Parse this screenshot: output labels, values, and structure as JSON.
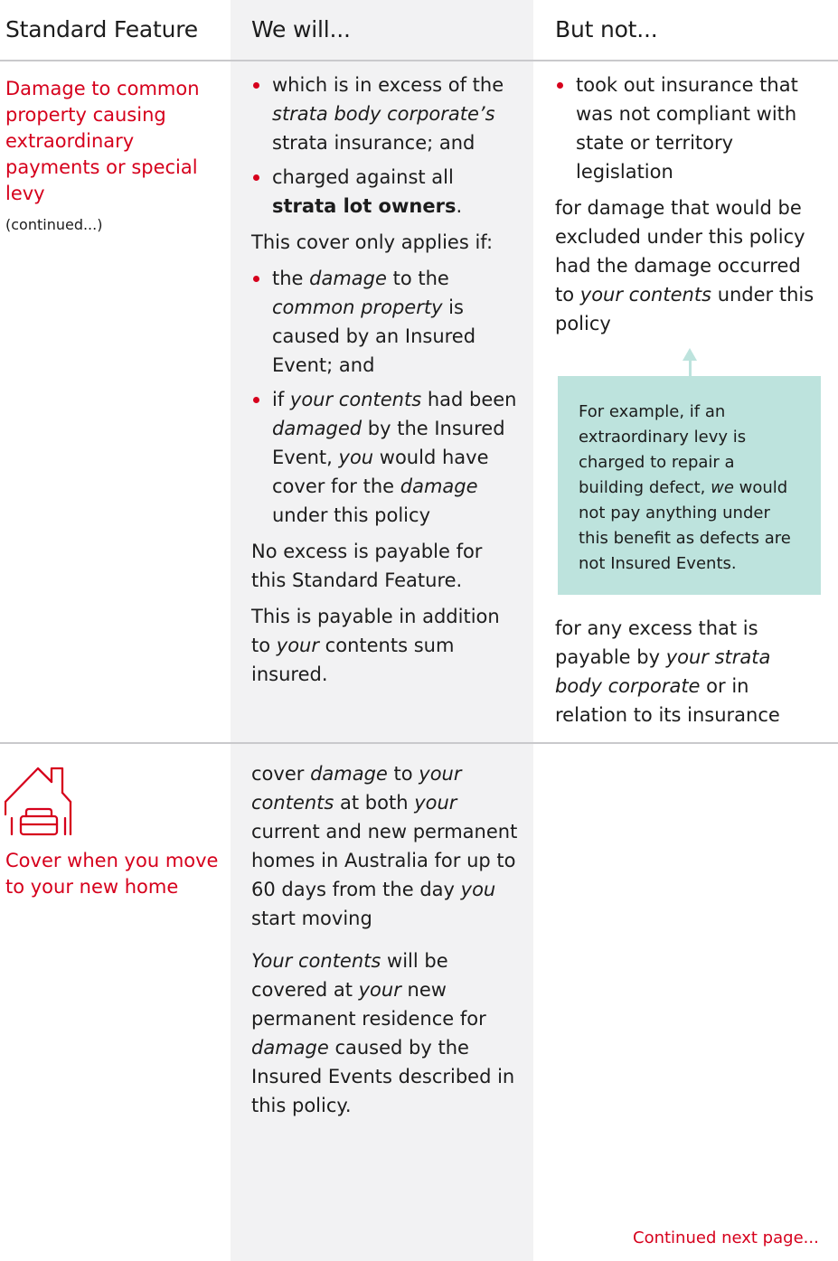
{
  "header": {
    "col1": "Standard Feature",
    "col2": "We will...",
    "col3": "But not..."
  },
  "row1": {
    "feature_title": "Damage to common property causing extraordinary payments or special levy",
    "continued": "(continued...)",
    "we_will": {
      "b1_a": "which is in excess of the ",
      "b1_b": "strata body corporate’s",
      "b1_c": " strata insurance; and",
      "b2_a": "charged against all ",
      "b2_b": "strata lot owners",
      "b2_c": ".",
      "applies_if": "This cover only applies if:",
      "b3_a": "the ",
      "b3_b": "damage",
      "b3_c": " to the ",
      "b3_d": "common property",
      "b3_e": " is caused by an Insured Event; and",
      "b4_a": "if ",
      "b4_b": "your contents",
      "b4_c": " had been ",
      "b4_d": "damaged",
      "b4_e": " by the Insured Event, ",
      "b4_f": "you",
      "b4_g": " would have cover for the ",
      "b4_h": "damage",
      "b4_i": " under this policy",
      "p_excess": "No excess is payable for this Standard Feature.",
      "p_addition_a": "This is payable in addition to ",
      "p_addition_b": "your",
      "p_addition_c": " contents sum insured."
    },
    "but_not": {
      "b1": "took out insurance that was not compliant with state or territory legislation",
      "p1_a": "for damage that would be excluded under this policy had the damage occurred to ",
      "p1_b": "your contents",
      "p1_c": " under this policy",
      "example_a": "For example, if an extraordinary levy is charged to repair a building defect, ",
      "example_b": "we",
      "example_c": " would not pay anything under this benefit as defects are not Insured Events.",
      "p2_a": "for any excess that is payable by ",
      "p2_b": "your strata body corporate",
      "p2_c": " or in relation to its insurance"
    }
  },
  "row2": {
    "icon": "house-sofa-icon",
    "feature_title": "Cover when you move to your new home",
    "we_will": {
      "p1_a": "cover ",
      "p1_b": "damage",
      "p1_c": " to ",
      "p1_d": "your contents",
      "p1_e": " at both ",
      "p1_f": "your",
      "p1_g": " current and new permanent homes in Australia for up to 60 days from the day ",
      "p1_h": "you",
      "p1_i": " start moving",
      "p2_a": "Your contents",
      "p2_b": " will be covered at ",
      "p2_c": "your",
      "p2_d": " new permanent residence for ",
      "p2_e": "damage",
      "p2_f": " caused by the Insured Events described in this policy."
    }
  },
  "footer": {
    "continued_next": "Continued next page..."
  },
  "colors": {
    "accent_red": "#d6001c",
    "column_grey": "#f2f2f3",
    "example_teal": "#bde3dd"
  }
}
